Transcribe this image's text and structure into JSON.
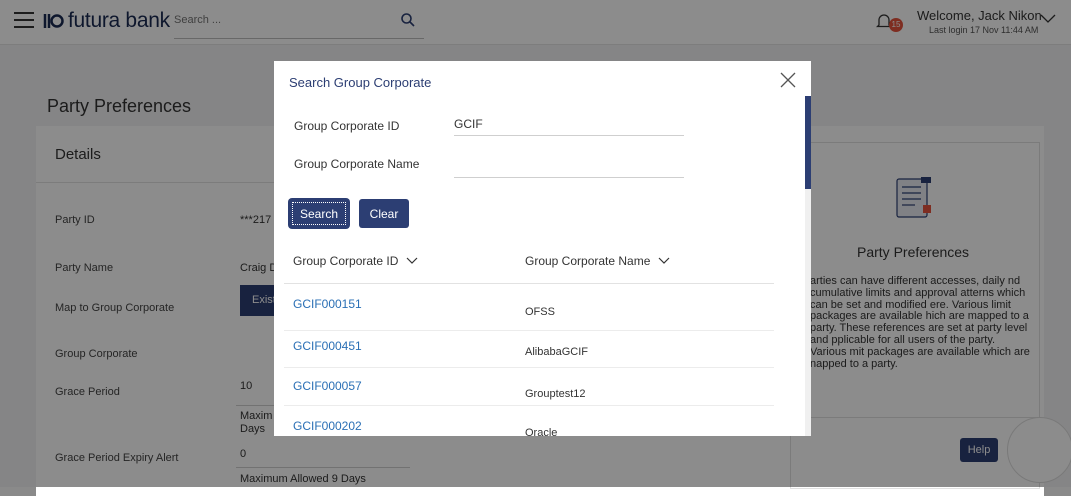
{
  "header": {
    "brand": "futura bank",
    "search_placeholder": "Search ...",
    "notification_count": "15",
    "welcome": "Welcome, Jack Nikon",
    "last_login": "Last login 17 Nov 11:44 AM"
  },
  "page": {
    "title": "Party Preferences",
    "details_title": "Details",
    "fields": [
      {
        "label": "Party ID",
        "value": "***217"
      },
      {
        "label": "Party Name",
        "value": "Craig D"
      },
      {
        "label": "Map to Group Corporate",
        "value": "Exist"
      },
      {
        "label": "Group Corporate",
        "value": ""
      },
      {
        "label": "Grace Period",
        "value": "10"
      },
      {
        "label": "Grace Period Expiry Alert",
        "value": "0"
      }
    ],
    "grace_note_line1": "Maxim",
    "grace_note_line2": "Days",
    "alert_note": "Maximum Allowed 9 Days"
  },
  "info_panel": {
    "title": "Party Preferences",
    "text": "arties can have different accesses, daily nd cumulative limits and approval atterns which can be set and modified ere. Various limit packages are available hich are mapped to a party. These references are set at party level and pplicable for all users of the party. Various mit packages are available which are napped to a party."
  },
  "help_label": "Help",
  "modal": {
    "title": "Search Group Corporate",
    "id_label": "Group Corporate ID",
    "id_value": "GCIF",
    "name_label": "Group Corporate Name",
    "name_value": "",
    "search_button": "Search",
    "clear_button": "Clear",
    "col_id": "Group Corporate ID",
    "col_name": "Group Corporate Name",
    "rows": [
      {
        "id": "GCIF000151",
        "name": "OFSS"
      },
      {
        "id": "GCIF000451",
        "name": "AlibabaGCIF"
      },
      {
        "id": "GCIF000057",
        "name": "Grouptest12"
      },
      {
        "id": "GCIF000202",
        "name": "Oracle"
      }
    ]
  },
  "colors": {
    "primary": "#2c3e73",
    "link": "#2a6fb5",
    "badge": "#e5533d"
  }
}
